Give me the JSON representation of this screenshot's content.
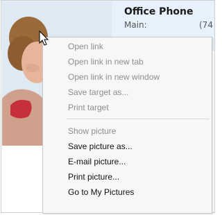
{
  "contact_card": {
    "title": "Office Phone",
    "main_label": "Main:",
    "main_value": "(74"
  },
  "context_menu": {
    "items": [
      {
        "label": "Open link",
        "enabled": false
      },
      {
        "label": "Open link in new tab",
        "enabled": false
      },
      {
        "label": "Open link in new window",
        "enabled": false
      },
      {
        "label": "Save target as...",
        "enabled": false
      },
      {
        "label": "Print target",
        "enabled": false
      },
      {
        "label": "Show picture",
        "enabled": false
      },
      {
        "label": "Save picture as...",
        "enabled": true
      },
      {
        "label": "E-mail picture...",
        "enabled": true
      },
      {
        "label": "Print picture...",
        "enabled": true
      },
      {
        "label": "Go to My Pictures",
        "enabled": true
      }
    ]
  },
  "icons": {
    "cursor": "arrow-pointer-icon"
  },
  "colors": {
    "header_bg": "#e6f1fb",
    "menu_bg": "#f7f7f7",
    "disabled_text": "#8e8e8e",
    "enabled_text": "#111111"
  }
}
